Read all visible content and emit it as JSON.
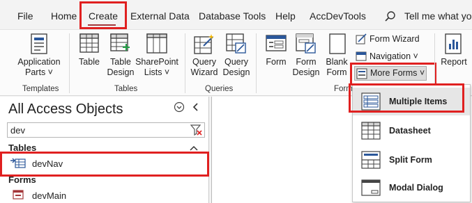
{
  "menubar": {
    "tabs": [
      {
        "label": "File"
      },
      {
        "label": "Home"
      },
      {
        "label": "Create"
      },
      {
        "label": "External Data"
      },
      {
        "label": "Database Tools"
      },
      {
        "label": "Help"
      },
      {
        "label": "AccDevTools"
      }
    ],
    "search_placeholder": "Tell me what you"
  },
  "ribbon": {
    "templates": {
      "application_parts_line1": "Application",
      "application_parts_line2": "Parts ˅",
      "group_label": "Templates"
    },
    "tables": {
      "table": "Table",
      "table_design_line1": "Table",
      "table_design_line2": "Design",
      "sharepoint_line1": "SharePoint",
      "sharepoint_line2": "Lists ˅",
      "group_label": "Tables"
    },
    "queries": {
      "query_wizard_line1": "Query",
      "query_wizard_line2": "Wizard",
      "query_design_line1": "Query",
      "query_design_line2": "Design",
      "group_label": "Queries"
    },
    "forms": {
      "form": "Form",
      "form_design_line1": "Form",
      "form_design_line2": "Design",
      "blank_form_line1": "Blank",
      "blank_form_line2": "Form",
      "form_wizard": "Form Wizard",
      "navigation": "Navigation ˅",
      "more_forms": "More Forms ˅",
      "group_label": "Forms"
    },
    "reports": {
      "report": "Report"
    }
  },
  "nav_pane": {
    "title": "All Access Objects",
    "search_value": "dev",
    "sections": [
      {
        "header": "Tables",
        "items": [
          {
            "label": "devNav"
          }
        ]
      },
      {
        "header": "Forms",
        "items": [
          {
            "label": "devMain"
          }
        ]
      }
    ]
  },
  "more_forms_menu": {
    "items": [
      {
        "label": "Multiple Items"
      },
      {
        "label": "Datasheet"
      },
      {
        "label": "Split Form"
      },
      {
        "label": "Modal Dialog"
      }
    ]
  },
  "colors": {
    "highlight_red": "#e02020",
    "access_red": "#a4373a",
    "icon_blue": "#2b579a",
    "icon_green": "#22a046"
  }
}
